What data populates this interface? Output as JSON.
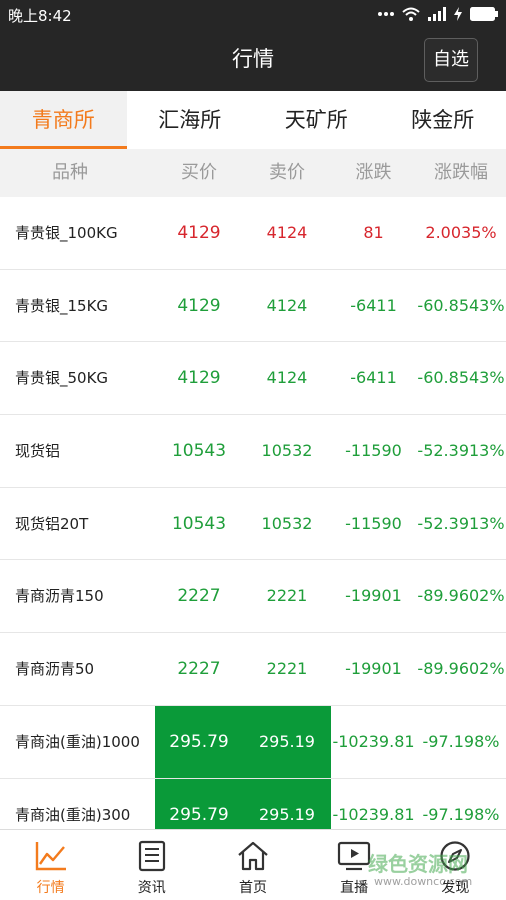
{
  "status_bar": {
    "time": "晚上8:42",
    "icons": [
      "dots-icon",
      "wifi-icon",
      "signal-icon",
      "bolt-icon",
      "battery-icon"
    ]
  },
  "header": {
    "title": "行情",
    "watchlist_label": "自选"
  },
  "tabs": [
    {
      "label": "青商所",
      "active": true
    },
    {
      "label": "汇海所",
      "active": false
    },
    {
      "label": "天矿所",
      "active": false
    },
    {
      "label": "陕金所",
      "active": false
    }
  ],
  "columns": {
    "name": "品种",
    "bid": "买价",
    "ask": "卖价",
    "change": "涨跌",
    "change_pct": "涨跌幅"
  },
  "rows": [
    {
      "name": "青贵银_100KG",
      "bid": "4129",
      "ask": "4124",
      "change": "81",
      "change_pct": "2.0035%",
      "trend": "up",
      "highlight": false
    },
    {
      "name": "青贵银_15KG",
      "bid": "4129",
      "ask": "4124",
      "change": "-6411",
      "change_pct": "-60.8543%",
      "trend": "down",
      "highlight": false
    },
    {
      "name": "青贵银_50KG",
      "bid": "4129",
      "ask": "4124",
      "change": "-6411",
      "change_pct": "-60.8543%",
      "trend": "down",
      "highlight": false
    },
    {
      "name": "现货铝",
      "bid": "10543",
      "ask": "10532",
      "change": "-11590",
      "change_pct": "-52.3913%",
      "trend": "down",
      "highlight": false
    },
    {
      "name": "现货铝20T",
      "bid": "10543",
      "ask": "10532",
      "change": "-11590",
      "change_pct": "-52.3913%",
      "trend": "down",
      "highlight": false
    },
    {
      "name": "青商沥青150",
      "bid": "2227",
      "ask": "2221",
      "change": "-19901",
      "change_pct": "-89.9602%",
      "trend": "down",
      "highlight": false
    },
    {
      "name": "青商沥青50",
      "bid": "2227",
      "ask": "2221",
      "change": "-19901",
      "change_pct": "-89.9602%",
      "trend": "down",
      "highlight": false
    },
    {
      "name": "青商油(重油)1000",
      "bid": "295.79",
      "ask": "295.19",
      "change": "-10239.81",
      "change_pct": "-97.198%",
      "trend": "down",
      "highlight": true
    },
    {
      "name": "青商油(重油)300",
      "bid": "295.79",
      "ask": "295.19",
      "change": "-10239.81",
      "change_pct": "-97.198%",
      "trend": "down",
      "highlight": true
    }
  ],
  "bottom_nav": [
    {
      "label": "行情",
      "icon": "chart-line-icon",
      "active": true
    },
    {
      "label": "资讯",
      "icon": "news-icon",
      "active": false
    },
    {
      "label": "首页",
      "icon": "home-icon",
      "active": false
    },
    {
      "label": "直播",
      "icon": "live-tv-icon",
      "active": false
    },
    {
      "label": "发现",
      "icon": "compass-icon",
      "active": false
    }
  ],
  "watermark": {
    "text": "绿色资源网",
    "url_text": "www.downcc.com"
  },
  "colors": {
    "accent": "#f37b1d",
    "up": "#d7262d",
    "down": "#1f9e3a",
    "highlight": "#0a9a39",
    "header_bg": "#262626"
  }
}
